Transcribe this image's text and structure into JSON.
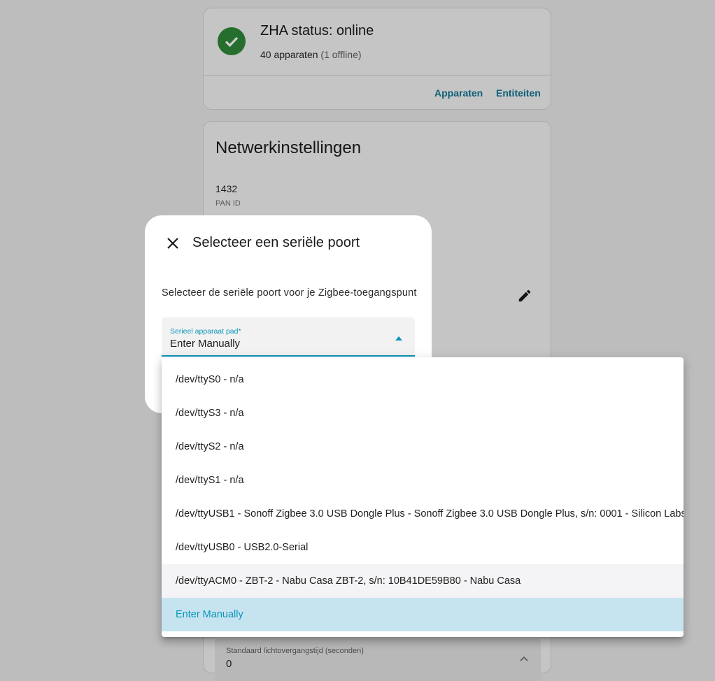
{
  "status_card": {
    "title": "ZHA status: online",
    "devices": "40 apparaten",
    "offline": "(1 offline)",
    "devices_link": "Apparaten",
    "entities_link": "Entiteiten",
    "status_icon": "check-circle-icon",
    "status_color": "#256e2e"
  },
  "network_card": {
    "title": "Netwerkinstellingen",
    "pan_id_value": "1432",
    "pan_id_label": "PAN ID",
    "edit_icon": "pencil-icon",
    "transition_label": "Standaard lichtovergangstijd (seconden)",
    "transition_value": "0"
  },
  "dialog": {
    "title": "Selecteer een seriële poort",
    "description": "Selecteer de seriële poort voor je Zigbee-toegangspunt",
    "select_label": "Serieel apparaat pad*",
    "select_value": "Enter Manually",
    "accent_color": "#0a95b8"
  },
  "dropdown": {
    "options": [
      "/dev/ttyS0 - n/a",
      "/dev/ttyS3 - n/a",
      "/dev/ttyS2 - n/a",
      "/dev/ttyS1 - n/a",
      "/dev/ttyUSB1 - Sonoff Zigbee 3.0 USB Dongle Plus - Sonoff Zigbee 3.0 USB Dongle Plus, s/n: 0001 - Silicon Labs",
      "/dev/ttyUSB0 - USB2.0-Serial",
      "/dev/ttyACM0 - ZBT-2 - Nabu Casa ZBT-2, s/n: 10B41DE59B80 - Nabu Casa",
      "Enter Manually"
    ],
    "hovered_option": "/dev/ttyACM0 - ZBT-2 - Nabu Casa ZBT-2, s/n: 10B41DE59B80 - Nabu Casa",
    "selected_option": "Enter Manually"
  }
}
